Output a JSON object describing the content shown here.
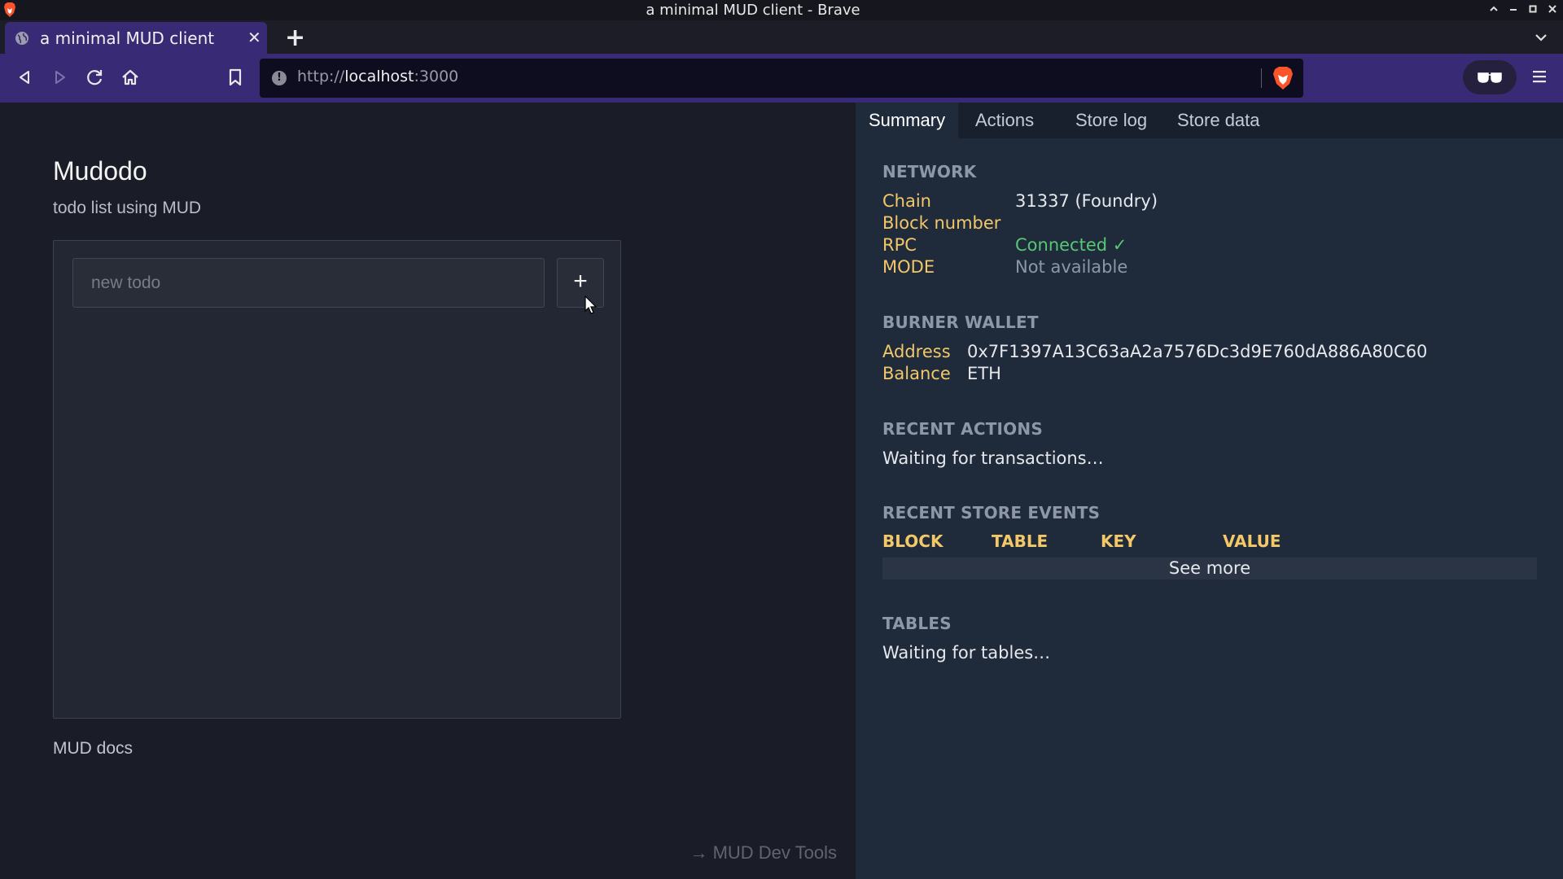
{
  "window": {
    "title": "a minimal MUD client - Brave"
  },
  "browser": {
    "tab": {
      "title": "a minimal MUD client",
      "favicon": "globe-icon"
    },
    "url": {
      "scheme": "http://",
      "host": "localhost",
      "port": ":3000"
    },
    "icons": [
      "back-icon",
      "forward-icon",
      "reload-icon",
      "home-icon",
      "bookmark-icon",
      "brave-shield-icon",
      "wallet-icon",
      "menu-icon"
    ]
  },
  "app": {
    "title": "Mudodo",
    "subtitle": "todo list using MUD",
    "todo_input": {
      "placeholder": "new todo",
      "value": ""
    },
    "add_button": "+",
    "docs_link": "MUD docs",
    "devtools_link": "→ MUD Dev Tools"
  },
  "devtools": {
    "tabs": [
      "Summary",
      "Actions",
      "Store log",
      "Store data"
    ],
    "active_tab": "Summary",
    "network": {
      "heading": "NETWORK",
      "chain_label": "Chain",
      "chain_value": "31337 (Foundry)",
      "block_label": "Block number",
      "block_value": "",
      "rpc_label": "RPC",
      "rpc_value": "Connected ✓",
      "mode_label": "MODE",
      "mode_value": "Not available"
    },
    "wallet": {
      "heading": "BURNER WALLET",
      "address_label": "Address",
      "address_value": "0x7F1397A13C63aA2a7576Dc3d9E760dA886A80C60",
      "balance_label": "Balance",
      "balance_value": "ETH"
    },
    "recent_actions": {
      "heading": "RECENT ACTIONS",
      "status": "Waiting for transactions…"
    },
    "recent_store_events": {
      "heading": "RECENT STORE EVENTS",
      "columns": [
        "BLOCK",
        "TABLE",
        "KEY",
        "VALUE"
      ],
      "see_more": "See more"
    },
    "tables": {
      "heading": "TABLES",
      "status": "Waiting for tables…"
    }
  },
  "colors": {
    "accent_purple": "#382a75",
    "key_yellow": "#f2c868",
    "connected_green": "#58c776",
    "panel_bg": "#1f2a3b"
  }
}
